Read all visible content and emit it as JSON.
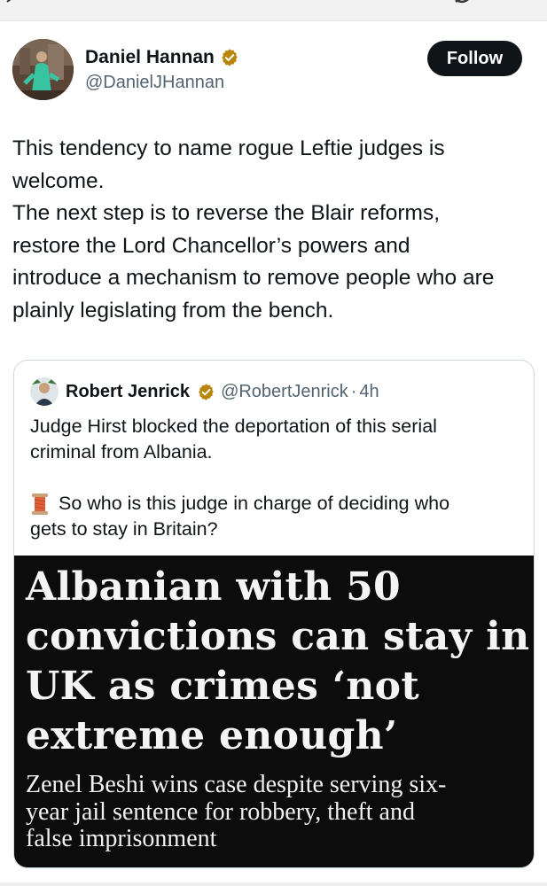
{
  "author": {
    "display_name": "Daniel Hannan",
    "handle": "@DanielJHannan",
    "verified_color": "#B8860B"
  },
  "follow_button": {
    "label": "Follow"
  },
  "tweet": {
    "lines": [
      "This tendency to name rogue Leftie judges is",
      "welcome.",
      "The next step is to reverse the Blair reforms,",
      "restore the Lord Chancellor’s powers and",
      "introduce a mechanism to remove people who are",
      "plainly legislating from the bench."
    ]
  },
  "quoted_tweet": {
    "display_name": "Robert Jenrick",
    "handle": "@RobertJenrick",
    "separator": "·",
    "time": "4h",
    "text_lines": [
      "Judge Hirst blocked the deportation of this serial",
      "criminal from Albania.",
      "So who is this judge in charge of deciding who",
      "gets to stay in Britain?"
    ],
    "emoji_icon": "thread-spool-icon",
    "media": {
      "headline_lines": [
        "Albanian with 50",
        "convictions can stay in",
        "UK as crimes ‘not",
        "extreme enough’"
      ],
      "subhead_lines": [
        "Zenel Beshi wins case despite serving six-",
        "year jail sentence for robbery, theft and",
        "false imprisonment"
      ]
    }
  },
  "colors": {
    "text_primary": "#0f1419",
    "text_secondary": "#536471",
    "follow_bg": "#0f1419",
    "media_bg": "#0c0c0c"
  }
}
